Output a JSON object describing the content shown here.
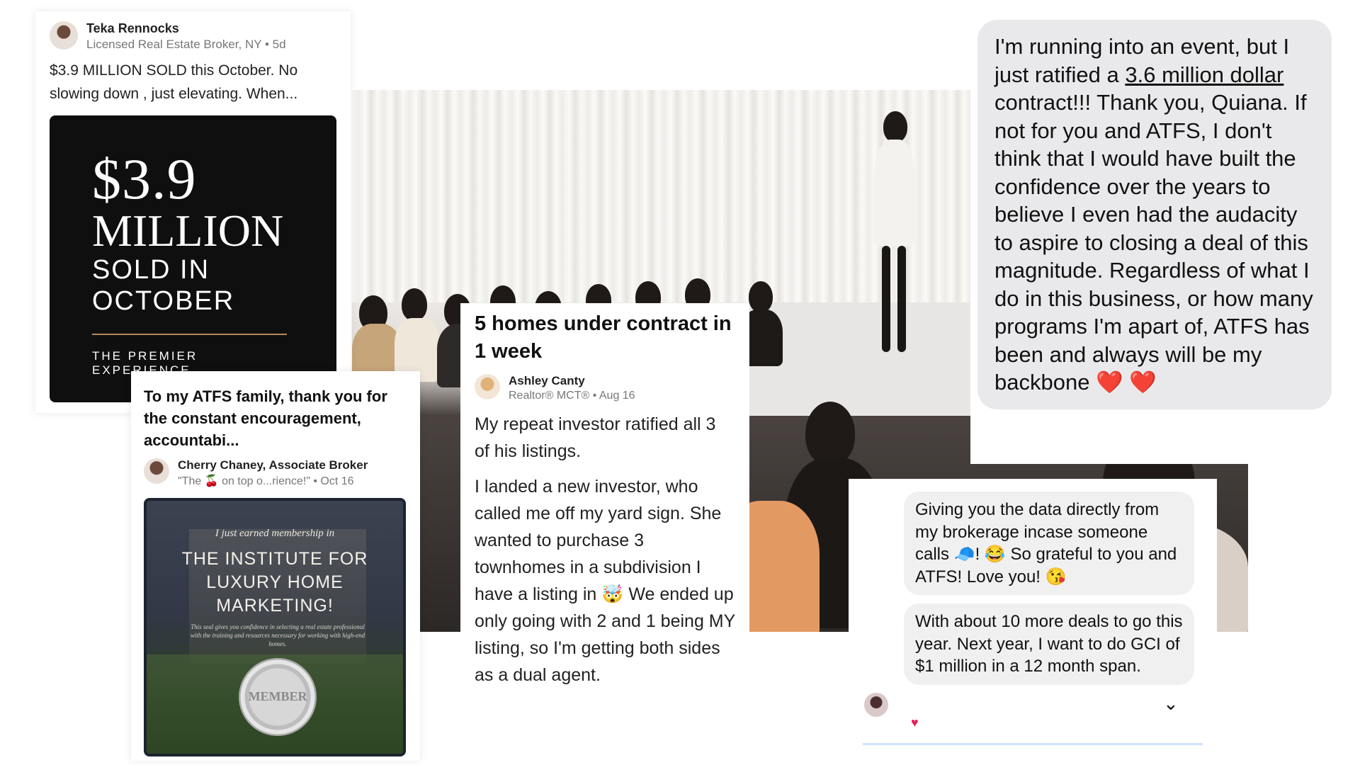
{
  "post_teka": {
    "author": "Teka Rennocks",
    "meta": "Licensed Real Estate Broker, NY • 5d",
    "text": "$3.9 MILLION SOLD this October. No slowing down , just elevating. When...",
    "graphic": {
      "amount": "$3.9",
      "unit": "MILLION",
      "line1": "SOLD IN",
      "line2": "OCTOBER",
      "tagline": "THE PREMIER EXPERIENCE"
    }
  },
  "post_cherry": {
    "title": "To my ATFS family, thank you for the constant encouragement, accountabi...",
    "author": "Cherry Chaney, Associate Broker",
    "meta": "\"The 🍒 on top o...rience!\" • Oct 16",
    "certificate": {
      "earned": "I just earned membership in",
      "institute": "THE INSTITUTE FOR LUXURY HOME MARKETING!",
      "fine_print": "This seal gives you confidence in selecting a real estate professional with the training and resources necessary for working with high-end homes.",
      "seal": "MEMBER"
    }
  },
  "post_ashley": {
    "title": "5 homes under contract in 1 week",
    "author": "Ashley Canty",
    "meta": "Realtor® MCT® • Aug 16",
    "paragraph1": "My repeat investor ratified all 3 of his listings.",
    "paragraph2": "I landed a new investor, who called me off my yard sign. She wanted to purchase 3 townhomes in a subdivision I have a listing in 🤯 We ended up only going with 2 and 1 being MY listing, so I'm getting both sides as a dual agent."
  },
  "quote_bubble": {
    "part1": "I'm running into an event, but I just ratified a ",
    "underlined": "3.6 million dollar",
    "part2": " contract!!! Thank you, Quiana. If not for you and ATFS, I don't think that I would have built the confidence over the years to believe I even had the audacity to aspire to closing a deal of this magnitude. Regardless of what I do in this business, or how many programs I'm apart of, ATFS has been and always will be my backbone ",
    "hearts": "❤️ ❤️"
  },
  "chat": {
    "message1": "Giving you the data directly from my brokerage incase someone calls 🧢! 😂 So grateful to you and ATFS! Love you! 😘",
    "message2": "With about 10 more deals to go this year. Next year, I want to do GCI of $1 million in a 12 month span.",
    "reaction": "♥",
    "chevron": "⌄"
  },
  "icons": [
    "avatar",
    "heart-icon",
    "chevron-down-icon",
    "member-seal-icon"
  ]
}
